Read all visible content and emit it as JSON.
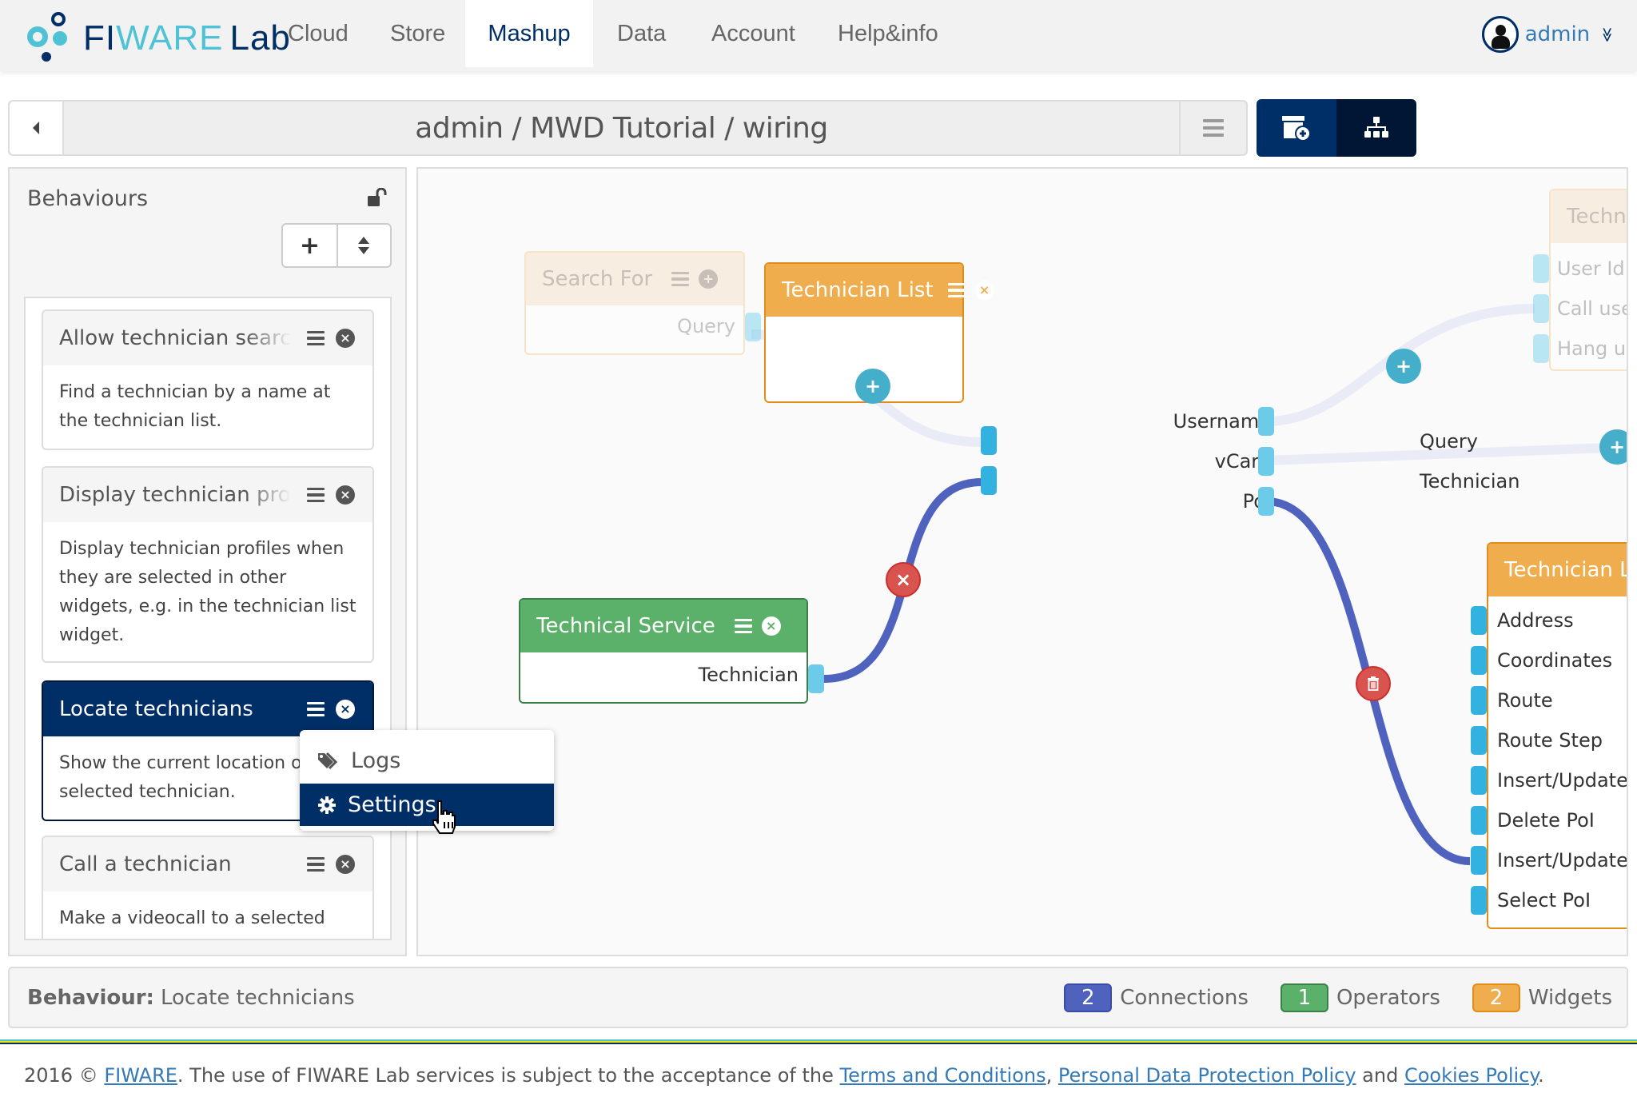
{
  "navbar": {
    "brand": {
      "fi": "FI",
      "ware": "WARE",
      "lab": "Lab"
    },
    "items": [
      {
        "label": "Cloud",
        "active": false
      },
      {
        "label": "Store",
        "active": false
      },
      {
        "label": "Mashup",
        "active": true
      },
      {
        "label": "Data",
        "active": false
      },
      {
        "label": "Account",
        "active": false
      },
      {
        "label": "Help&info",
        "active": false
      }
    ],
    "user": {
      "name": "admin",
      "caret": "≫"
    }
  },
  "breadcrumb": {
    "title": "admin / MWD Tutorial / wiring"
  },
  "view_toggle": {
    "buttons": [
      {
        "name": "components-icon",
        "active": false
      },
      {
        "name": "behaviours-icon",
        "active": true
      }
    ]
  },
  "sidebar": {
    "title": "Behaviours",
    "lock_icon": "unlock-icon",
    "add_label": "+",
    "order_label": "⇕",
    "behaviours": [
      {
        "name": "Allow technician search",
        "description": "Find a technician by a name at the technician list.",
        "active": false
      },
      {
        "name": "Display technician profiles",
        "description": "Display technician profiles when they are selected in other widgets, e.g. in the technician list widget.",
        "active": false
      },
      {
        "name": "Locate technicians",
        "description": "Show the current location of a selected technician.",
        "active": true
      },
      {
        "name": "Call a technician",
        "description": "Make a videocall to a selected",
        "active": false
      }
    ]
  },
  "context_menu": {
    "items": [
      {
        "label": "Logs",
        "icon": "tags-icon",
        "selected": false
      },
      {
        "label": "Settings",
        "icon": "gear-icon",
        "selected": true
      }
    ]
  },
  "canvas": {
    "components": {
      "search_for": {
        "title": "Search For",
        "outputs": [
          "Query"
        ],
        "state": "inactive"
      },
      "technician_list": {
        "title": "Technician List",
        "inputs": [
          "Query",
          "Technician"
        ],
        "outputs": [
          "Username",
          "vCard",
          "PoI"
        ],
        "state": "active"
      },
      "technical_service": {
        "title": "Technical Service",
        "outputs": [
          "Technician"
        ],
        "type": "operator"
      },
      "technician_map": {
        "title": "Technician Location",
        "inputs": [
          "Address",
          "Coordinates",
          "Route",
          "Route Step",
          "Insert/Update PoI",
          "Delete PoI",
          "Insert/Update Centered PoI",
          "Select PoI"
        ],
        "state": "active"
      },
      "technician_call": {
        "title": "Technician VideoCall",
        "inputs": [
          "User Id",
          "Call user",
          "Hang up"
        ],
        "state": "inactive"
      }
    },
    "connection_buttons": {
      "add": "+",
      "remove": "×",
      "delete": "trash-icon"
    }
  },
  "statusbar": {
    "label": "Behaviour:",
    "value": "Locate technicians",
    "counters": [
      {
        "count": "2",
        "label": "Connections",
        "color": "#4f62bd",
        "border": "#3a4ca5"
      },
      {
        "count": "1",
        "label": "Operators",
        "color": "#5bb06a",
        "border": "#3b8048"
      },
      {
        "count": "2",
        "label": "Widgets",
        "color": "#f0ad4e",
        "border": "#e08e1b"
      }
    ]
  },
  "footer": {
    "prefix": "2016 © ",
    "fiware": "FIWARE",
    "text1": ". The use of FIWARE Lab services is subject to the acceptance of the ",
    "terms": "Terms and Conditions",
    "sep": ", ",
    "privacy": "Personal Data Protection Policy",
    "and": " and ",
    "cookies": "Cookies Policy",
    "end": "."
  },
  "colors": {
    "brand_dark": "#002e67",
    "brand_light": "#4fc2d5",
    "widget_orange": "#f0ad4e",
    "operator_green": "#5bb06a",
    "connection_blue": "#4f62bd",
    "danger_red": "#d9534f",
    "link_blue": "#337ab7"
  }
}
